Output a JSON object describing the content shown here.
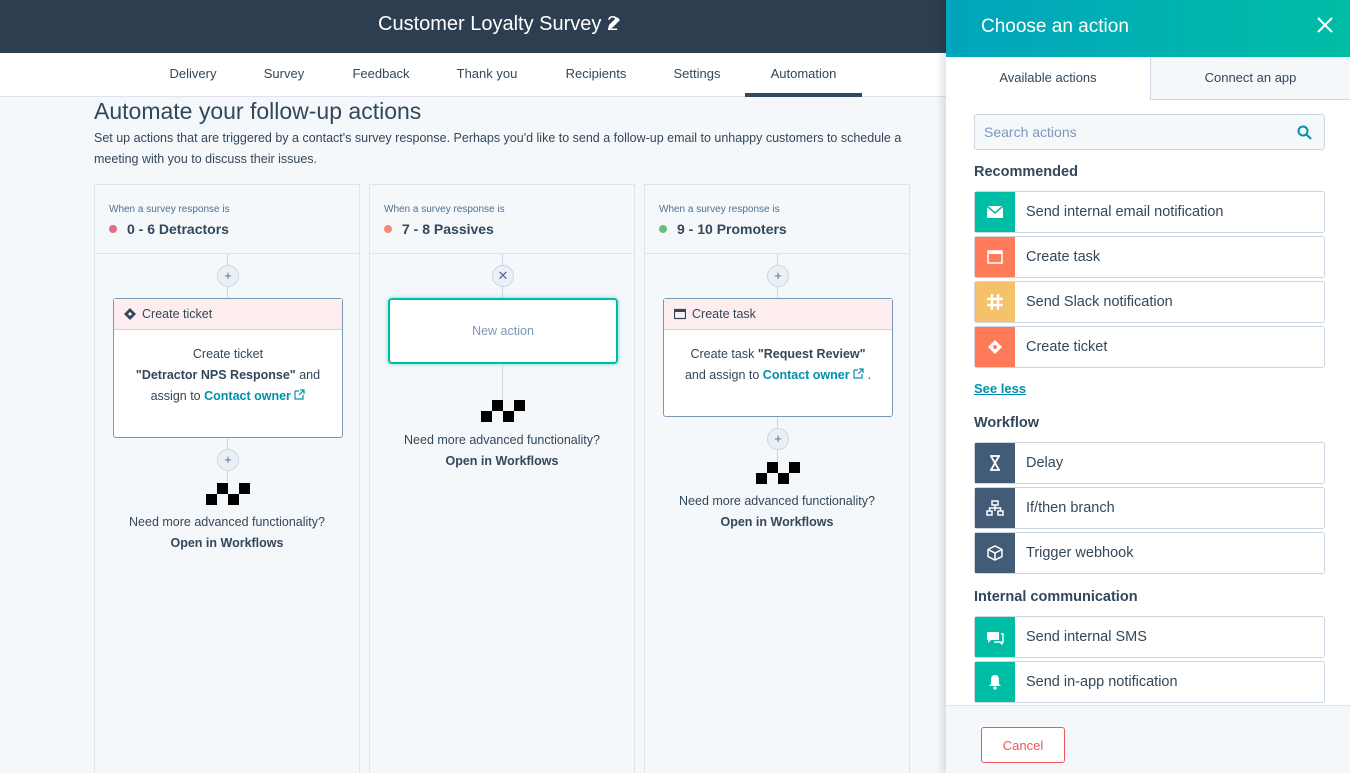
{
  "header": {
    "title": "Customer Loyalty Survey 2"
  },
  "tabs": [
    "Delivery",
    "Survey",
    "Feedback",
    "Thank you",
    "Recipients",
    "Settings",
    "Automation"
  ],
  "main": {
    "title": "Automate your follow-up actions",
    "description": "Set up actions that are triggered by a contact's survey response. Perhaps you'd like to send a follow-up email to unhappy customers to schedule a meeting with you to discuss their issues."
  },
  "columns": [
    {
      "caption": "When a survey response is",
      "range": "0 - 6 Detractors",
      "dot_color": "#e06c86",
      "card": {
        "header": "Create ticket",
        "line1": "Create ticket",
        "bold": "\"Detractor NPS Response\"",
        "and": " and",
        "assign": "assign to ",
        "owner": "Contact owner"
      },
      "more": "Need more advanced functionality?",
      "open": "Open in Workflows"
    },
    {
      "caption": "When a survey response is",
      "range": "7 - 8 Passives",
      "dot_color": "#f08d7a",
      "new_action": "New action",
      "more": "Need more advanced functionality?",
      "open": "Open in Workflows"
    },
    {
      "caption": "When a survey response is",
      "range": "9 - 10 Promoters",
      "dot_color": "#6dbd7b",
      "card": {
        "header": "Create task",
        "line1": "Create task ",
        "bold": "\"Request Review\"",
        "assign": "and assign to ",
        "owner": "Contact owner",
        "end": " ."
      },
      "more": "Need more advanced functionality?",
      "open": "Open in Workflows"
    }
  ],
  "panel": {
    "title": "Choose an action",
    "tabs": {
      "available": "Available actions",
      "connect": "Connect an app"
    },
    "search_placeholder": "Search actions",
    "recommended": {
      "title": "Recommended",
      "items": [
        {
          "label": "Send internal email notification",
          "color": "#00bda5",
          "icon": "envelope-icon"
        },
        {
          "label": "Create task",
          "color": "#ff7a59",
          "icon": "task-icon"
        },
        {
          "label": "Send Slack notification",
          "color": "#f5c26b",
          "icon": "slack-icon"
        },
        {
          "label": "Create ticket",
          "color": "#ff7a59",
          "icon": "ticket-icon"
        }
      ]
    },
    "see_less": "See less",
    "workflow": {
      "title": "Workflow",
      "items": [
        {
          "label": "Delay",
          "color": "#425b76",
          "icon": "hourglass-icon"
        },
        {
          "label": "If/then branch",
          "color": "#425b76",
          "icon": "branch-icon"
        },
        {
          "label": "Trigger webhook",
          "color": "#425b76",
          "icon": "cube-icon"
        }
      ]
    },
    "internal": {
      "title": "Internal communication",
      "items": [
        {
          "label": "Send internal SMS",
          "color": "#00bda5",
          "icon": "sms-icon"
        },
        {
          "label": "Send in-app notification",
          "color": "#00bda5",
          "icon": "bell-icon"
        }
      ]
    },
    "cancel": "Cancel"
  }
}
